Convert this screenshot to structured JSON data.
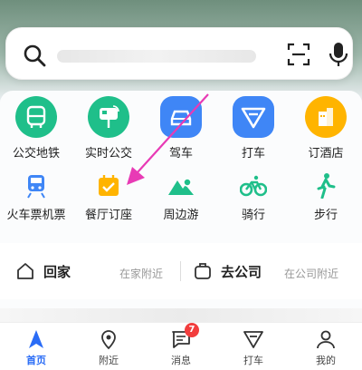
{
  "search": {
    "placeholder": ""
  },
  "row1": [
    {
      "label": "公交地铁",
      "icon": "bus-icon",
      "bg": "#1fbf8a"
    },
    {
      "label": "实时公交",
      "icon": "bus-stop-icon",
      "bg": "#1fbf8a"
    },
    {
      "label": "驾车",
      "icon": "car-icon",
      "bg": "#3f86f6"
    },
    {
      "label": "打车",
      "icon": "taxi-logo-icon",
      "bg": "#3f86f6"
    },
    {
      "label": "订酒店",
      "icon": "hotel-icon",
      "bg": "#ffb400"
    }
  ],
  "row2": [
    {
      "label": "火车票机票",
      "icon": "train-icon",
      "color": "#3f86f6"
    },
    {
      "label": "餐厅订座",
      "icon": "restaurant-calendar-icon",
      "color": "#ffb400"
    },
    {
      "label": "周边游",
      "icon": "mountain-location-icon",
      "color": "#1fbf8a"
    },
    {
      "label": "骑行",
      "icon": "bicycle-icon",
      "color": "#1fbf8a"
    },
    {
      "label": "步行",
      "icon": "walking-icon",
      "color": "#1fbf8a"
    }
  ],
  "home": {
    "title": "回家",
    "sub": "在家附近"
  },
  "work": {
    "title": "去公司",
    "sub": "在公司附近"
  },
  "tabs": [
    {
      "label": "首页",
      "icon": "home-arrow-icon"
    },
    {
      "label": "附近",
      "icon": "location-pin-icon"
    },
    {
      "label": "消息",
      "icon": "message-icon",
      "badge": "7"
    },
    {
      "label": "打车",
      "icon": "taxi-icon"
    },
    {
      "label": "我的",
      "icon": "user-icon"
    }
  ],
  "colors": {
    "accent": "#2a6cf6",
    "green": "#1fbf8a",
    "blue": "#3f86f6",
    "yellow": "#ffb400",
    "badge": "#f23d3d",
    "annotation": "#e83ab5"
  }
}
